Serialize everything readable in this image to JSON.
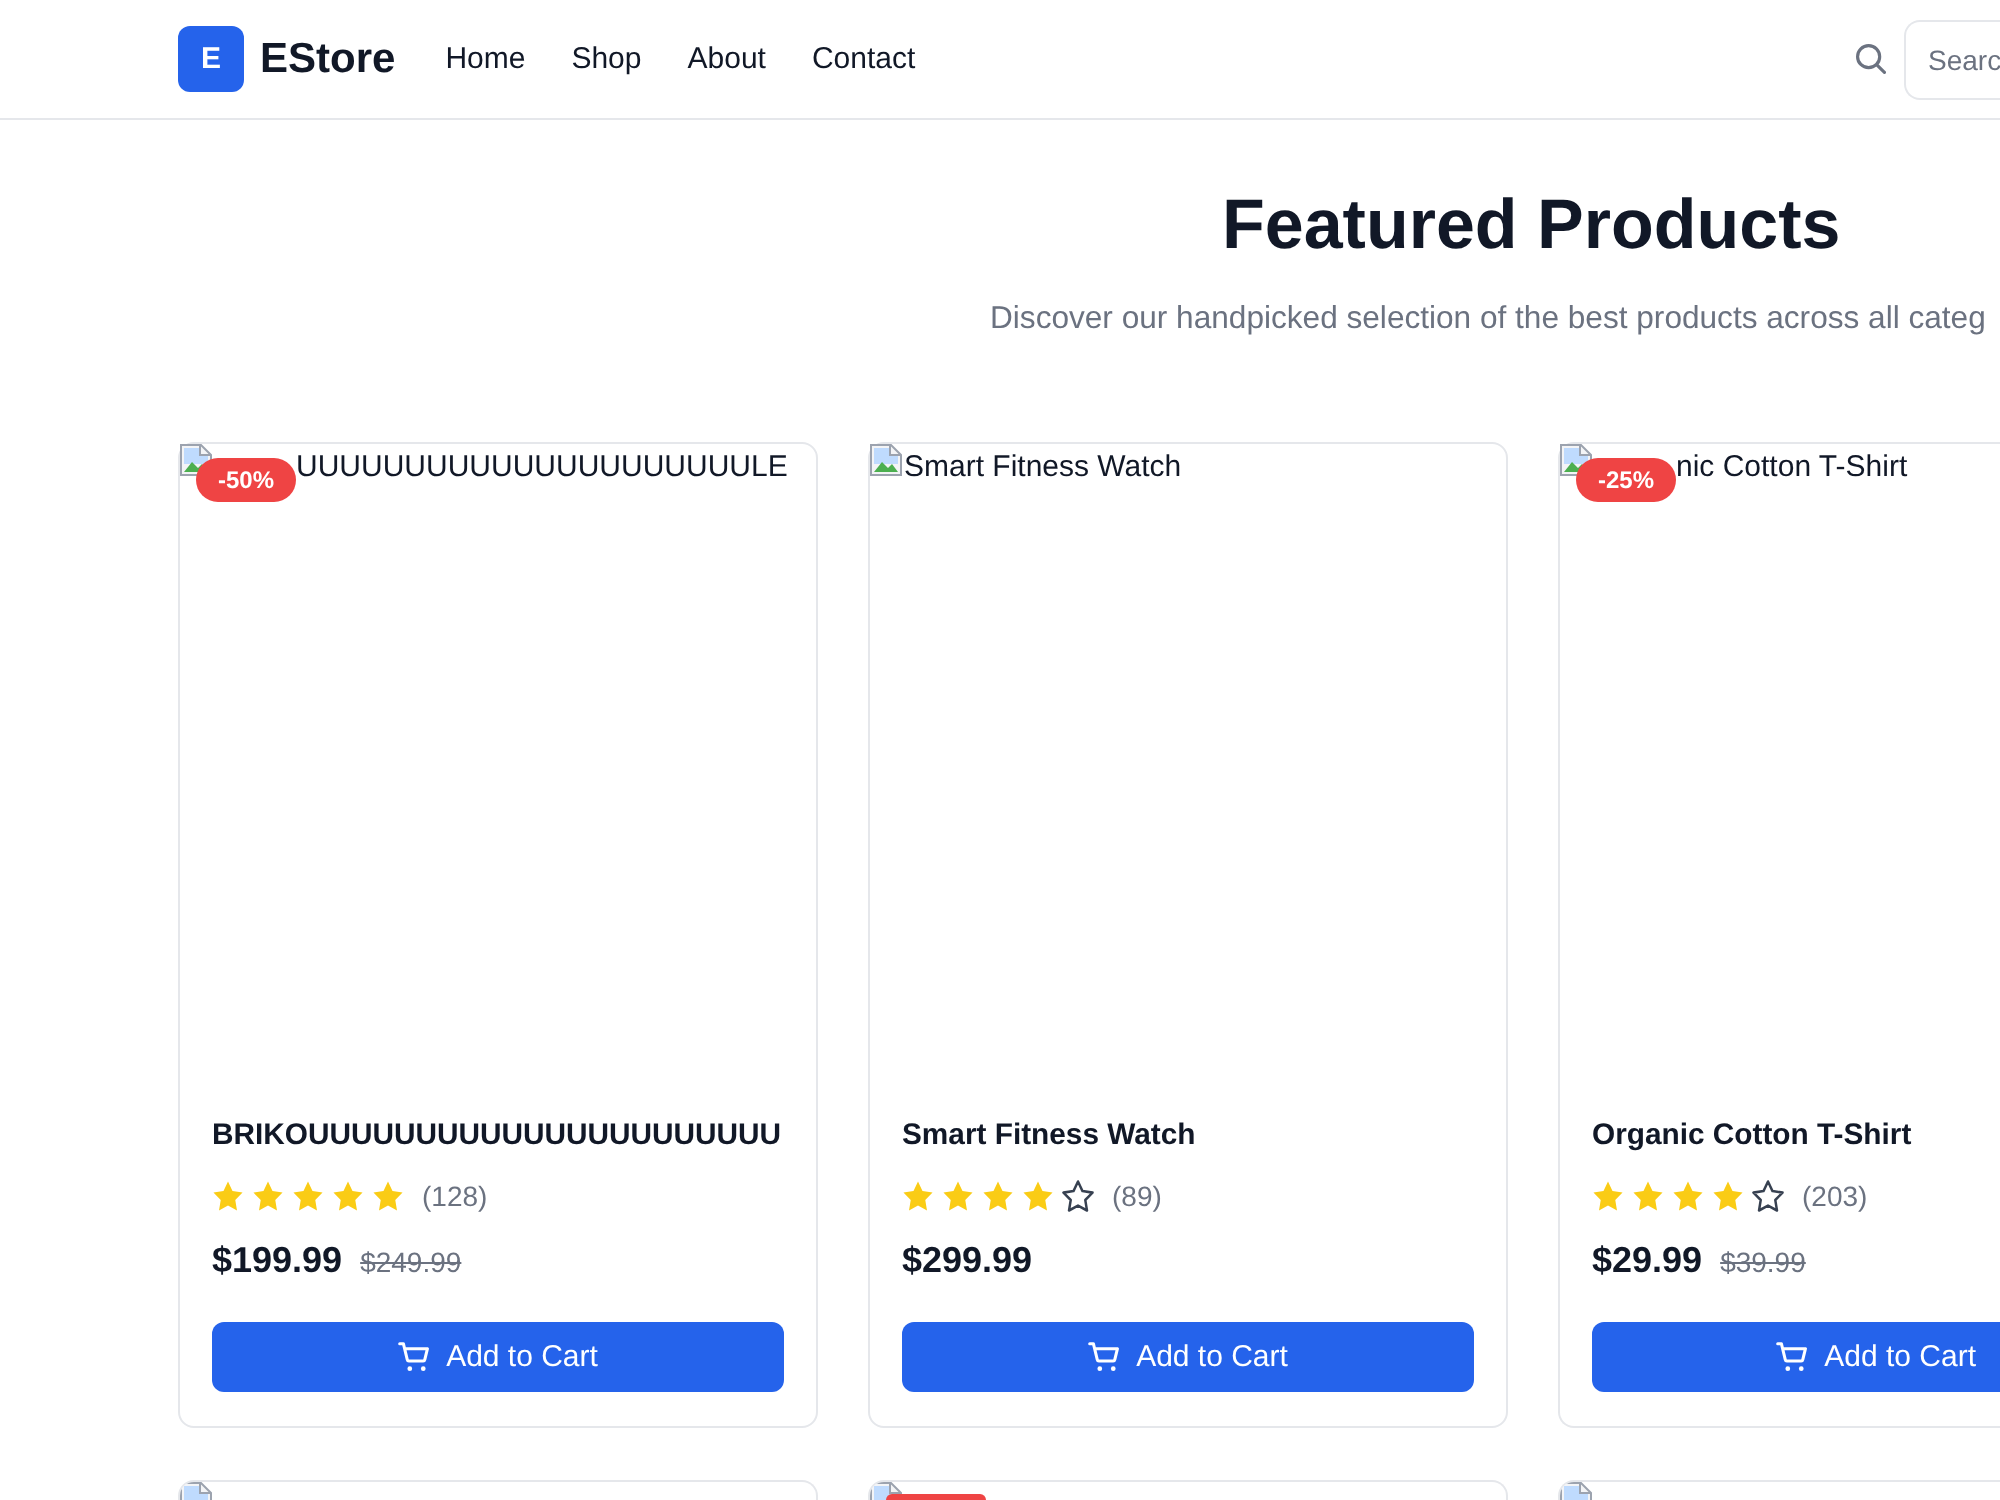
{
  "header": {
    "logo": {
      "letter": "E",
      "name": "EStore"
    },
    "nav": [
      {
        "label": "Home"
      },
      {
        "label": "Shop"
      },
      {
        "label": "About"
      },
      {
        "label": "Contact"
      }
    ],
    "search": {
      "placeholder": "Searc"
    }
  },
  "hero": {
    "title": "Featured Products",
    "subtitle": "Discover our handpicked selection of the best products across all categ"
  },
  "products": [
    {
      "image_alt": "UUUUUUUUUUUUUUUUUUUUULE",
      "badge": "-50%",
      "name": "BRIKOUUUUUUUUUUUUUUUUUUUUUU",
      "stars": 5,
      "reviews": "(128)",
      "price": "$199.99",
      "old_price": "$249.99",
      "button": "Add to Cart"
    },
    {
      "image_alt": "Smart Fitness Watch",
      "name": "Smart Fitness Watch",
      "stars": 4,
      "reviews": "(89)",
      "price": "$299.99",
      "button": "Add to Cart"
    },
    {
      "image_alt": "nic Cotton T-Shirt",
      "badge": "-25%",
      "name": "Organic Cotton T-Shirt",
      "stars": 4,
      "reviews": "(203)",
      "price": "$29.99",
      "old_price": "$39.99",
      "button": "Add to Cart"
    }
  ],
  "more_products": [
    {
      "discounted": false
    },
    {
      "discounted": true
    },
    {
      "discounted": false
    }
  ]
}
